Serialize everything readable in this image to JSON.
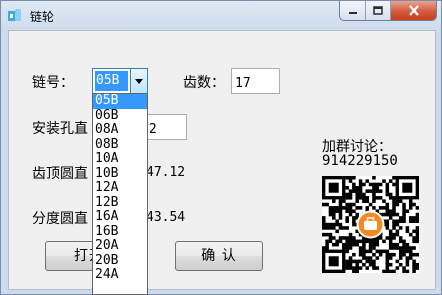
{
  "window": {
    "title": "链轮"
  },
  "labels": {
    "chain_no": "链号：",
    "teeth": "齿数：",
    "bore": "安装孔直",
    "tip_diameter": "齿顶圆直",
    "pitch_diameter": "分度圆直",
    "group_title": "加群讨论：",
    "group_number": "914229150"
  },
  "fields": {
    "chain_no_value": "05B",
    "teeth_value": "17",
    "bore_value": "22",
    "tip_diameter_value": "47.12",
    "pitch_diameter_value": "43.54"
  },
  "dropdown": {
    "options": [
      "05B",
      "06B",
      "08A",
      "08B",
      "10A",
      "10B",
      "12A",
      "12B",
      "16A",
      "16B",
      "20A",
      "20B",
      "24A"
    ],
    "selected_index": 0
  },
  "buttons": {
    "open": "打开模",
    "confirm": "确 认"
  },
  "colors": {
    "selection": "#3399ff",
    "close_button": "#c5401f",
    "qr_badge": "#f08a24"
  },
  "icons": {
    "app": "gear-app-icon",
    "minimize": "minimize-icon",
    "maximize": "maximize-icon",
    "close": "close-icon",
    "dropdown_arrow": "chevron-down-icon",
    "qr": "qr-code-icon"
  }
}
